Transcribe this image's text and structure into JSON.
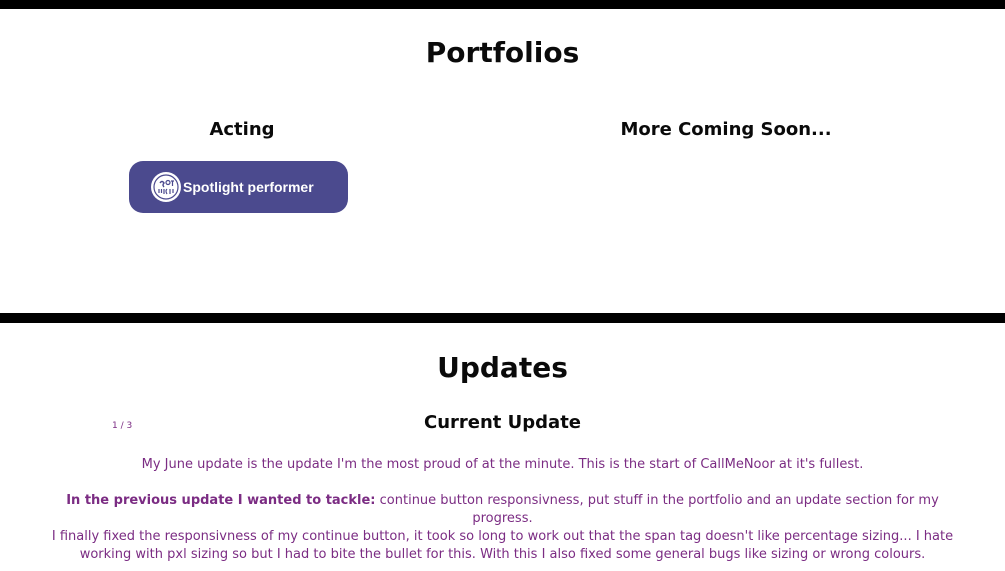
{
  "portfolios": {
    "title": "Portfolios",
    "columns": [
      {
        "heading": "Acting"
      },
      {
        "heading": "More Coming Soon..."
      }
    ],
    "spotlight_button": {
      "label": "Spotlight performer",
      "icon": "spotlight-logo-icon"
    }
  },
  "updates": {
    "title": "Updates",
    "counter": "1 / 3",
    "current_title": "Current Update",
    "paragraphs": {
      "p1": "My June update is the update I'm the most proud of at the minute. This is the start of CallMeNoor at it's fullest.",
      "p2_bold": "In the previous update I wanted to tackle:",
      "p2_rest": " continue button responsivness, put stuff in the portfolio and an update section for my progress.",
      "p3": "I finally fixed the responsivness of my continue button, it took so long to work out that the span tag doesn't like percentage sizing... I hate working with pxl sizing so but I had to bite the bullet for this. With this I also fixed some general bugs like sizing or wrong colours."
    }
  },
  "colors": {
    "spotlight_bg": "#4b4a8e",
    "update_text": "#7b2c83",
    "divider": "#000000"
  }
}
